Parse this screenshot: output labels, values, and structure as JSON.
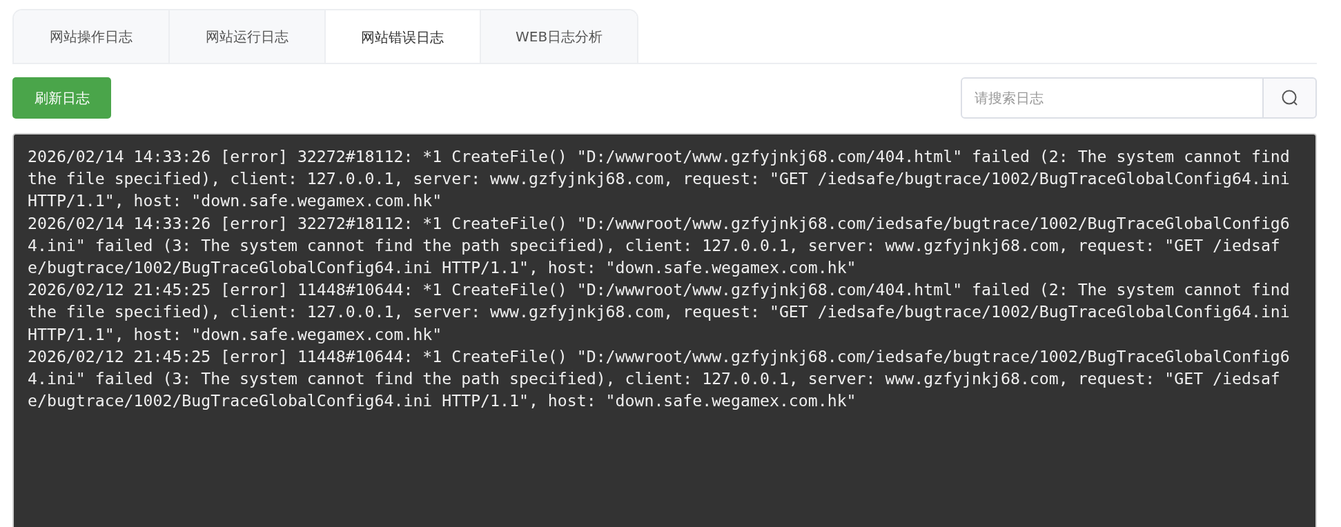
{
  "tabs": [
    {
      "label": "网站操作日志",
      "selected": false
    },
    {
      "label": "网站运行日志",
      "selected": false
    },
    {
      "label": "网站错误日志",
      "selected": true
    },
    {
      "label": "WEB日志分析",
      "selected": false
    }
  ],
  "refresh_button": {
    "label": "刷新日志"
  },
  "search": {
    "placeholder": "请搜索日志"
  },
  "log_entries": [
    "2026/02/14 14:33:26 [error] 32272#18112: *1 CreateFile() \"D:/wwwroot/www.gzfyjnkj68.com/404.html\" failed (2: The system cannot find the file specified), client: 127.0.0.1, server: www.gzfyjnkj68.com, request: \"GET /iedsafe/bugtrace/1002/BugTraceGlobalConfig64.ini HTTP/1.1\", host: \"down.safe.wegamex.com.hk\"",
    "2026/02/14 14:33:26 [error] 32272#18112: *1 CreateFile() \"D:/wwwroot/www.gzfyjnkj68.com/iedsafe/bugtrace/1002/BugTraceGlobalConfig64.ini\" failed (3: The system cannot find the path specified), client: 127.0.0.1, server: www.gzfyjnkj68.com, request: \"GET /iedsafe/bugtrace/1002/BugTraceGlobalConfig64.ini HTTP/1.1\", host: \"down.safe.wegamex.com.hk\"",
    "2026/02/12 21:45:25 [error] 11448#10644: *1 CreateFile() \"D:/wwwroot/www.gzfyjnkj68.com/404.html\" failed (2: The system cannot find the file specified), client: 127.0.0.1, server: www.gzfyjnkj68.com, request: \"GET /iedsafe/bugtrace/1002/BugTraceGlobalConfig64.ini HTTP/1.1\", host: \"down.safe.wegamex.com.hk\"",
    "2026/02/12 21:45:25 [error] 11448#10644: *1 CreateFile() \"D:/wwwroot/www.gzfyjnkj68.com/iedsafe/bugtrace/1002/BugTraceGlobalConfig64.ini\" failed (3: The system cannot find the path specified), client: 127.0.0.1, server: www.gzfyjnkj68.com, request: \"GET /iedsafe/bugtrace/1002/BugTraceGlobalConfig64.ini HTTP/1.1\", host: \"down.safe.wegamex.com.hk\""
  ]
}
